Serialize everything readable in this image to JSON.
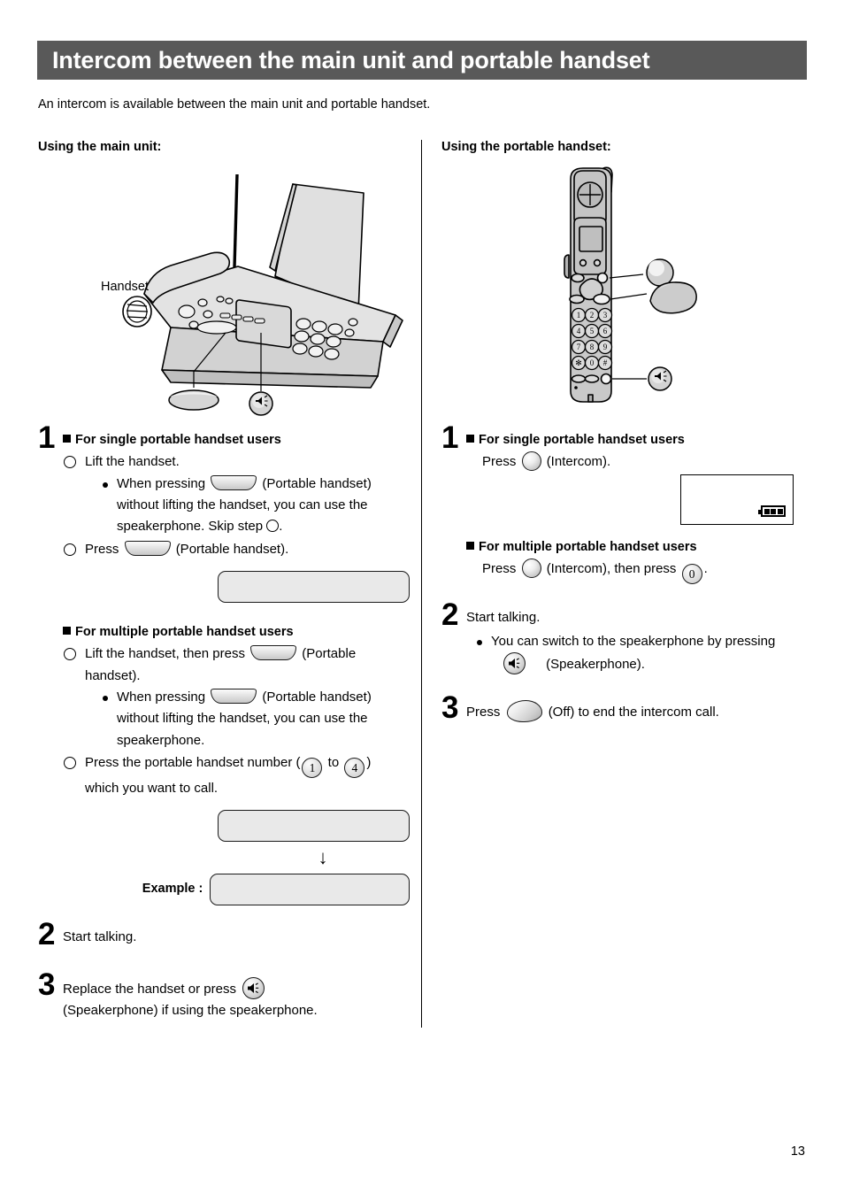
{
  "header": {
    "title": "Intercom between the main unit and portable handset"
  },
  "intro": "An intercom is available between the main unit and portable handset.",
  "left": {
    "heading": "Using the main unit:",
    "illustration": {
      "callout_handset": "Handset",
      "alt": "main-fax-unit"
    },
    "step1": {
      "number": "1",
      "single": {
        "heading": "For single portable handset users",
        "item1": "Lift the handset.",
        "note1_a": "When pressing",
        "note1_b": "(Portable handset)",
        "note1_c": "without lifting the handset, you can use the",
        "note1_d": "speakerphone. Skip step",
        "note1_e": ".",
        "item2_a": "Press",
        "item2_b": "(Portable handset)."
      },
      "multiple": {
        "heading": "For multiple portable handset users",
        "item1_a": "Lift the handset, then press",
        "item1_b": "(Portable",
        "item1_c": "handset).",
        "note1_a": "When pressing",
        "note1_b": "(Portable handset)",
        "note1_c": "without lifting the handset, you can use the",
        "note1_d": "speakerphone.",
        "item2_a": "Press the portable handset number (",
        "key_from": "1",
        "item2_mid": "to",
        "key_to": "4",
        "item2_b": ")",
        "item2_c": "which you want to call."
      },
      "example_label": "Example :",
      "arrow_glyph": "↓"
    },
    "step2": {
      "number": "2",
      "text": "Start talking."
    },
    "step3": {
      "number": "3",
      "text_a": "Replace the handset or press",
      "text_b": "(Speakerphone) if using the speakerphone."
    }
  },
  "right": {
    "heading": "Using the portable handset:",
    "illustration": {
      "alt": "portable-handset"
    },
    "step1": {
      "number": "1",
      "single": {
        "heading": "For single portable handset users",
        "text_a": "Press",
        "text_b": "(Intercom)."
      },
      "multiple": {
        "heading": "For multiple portable handset users",
        "text_a": "Press",
        "text_b": "(Intercom), then press",
        "key_zero": "0",
        "text_c": "."
      }
    },
    "step2": {
      "number": "2",
      "text": "Start talking.",
      "note_a": "You can switch to the speakerphone by pressing",
      "note_b": "(Speakerphone)."
    },
    "step3": {
      "number": "3",
      "text_a": "Press",
      "text_b": "(Off) to end the intercom call."
    }
  },
  "footer": {
    "page_number": "13"
  },
  "colors": {
    "header_bg": "#595959",
    "header_text": "#ffffff",
    "lcd_fill": "#e9e9e9",
    "body_text": "#000000"
  }
}
